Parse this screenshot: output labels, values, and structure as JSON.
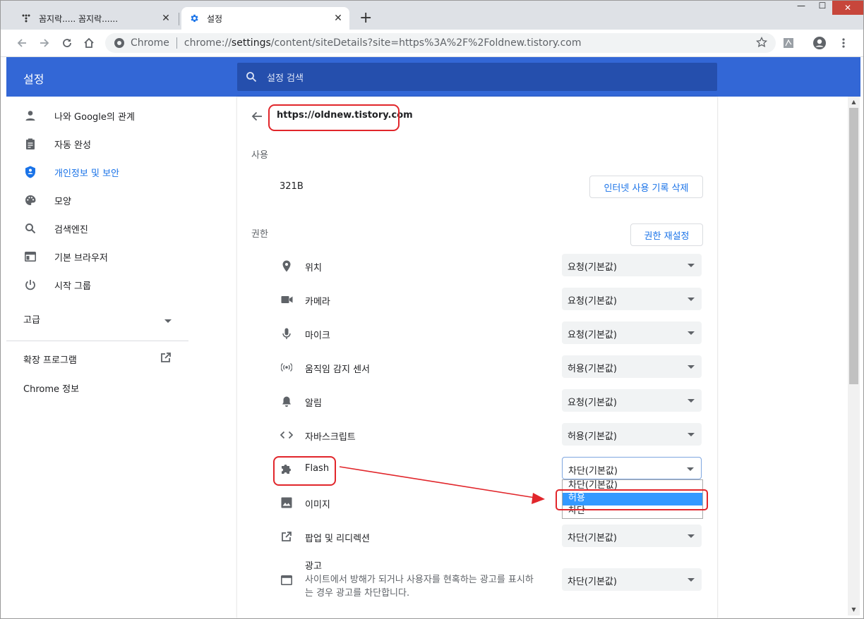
{
  "browser": {
    "tabs": [
      {
        "title": "꼼지락..... 꼼지락......",
        "close": "✕"
      },
      {
        "title": "설정",
        "close": "✕"
      }
    ],
    "new_tab": "+",
    "window_buttons": {
      "minimize": "—",
      "maximize": "☐",
      "close": "✕"
    },
    "omnibox": {
      "chip": "Chrome",
      "url_scheme": "chrome://",
      "url_host": "settings",
      "url_path": "/content/siteDetails?site=https%3A%2F%2Foldnew.tistory.com"
    }
  },
  "header": {
    "title": "설정",
    "search_placeholder": "설정 검색"
  },
  "sidebar": {
    "items": [
      {
        "label": "나와 Google의 관계",
        "icon": "person-icon"
      },
      {
        "label": "자동 완성",
        "icon": "clipboard-icon"
      },
      {
        "label": "개인정보 및 보안",
        "icon": "shield-icon",
        "active": true
      },
      {
        "label": "모양",
        "icon": "palette-icon"
      },
      {
        "label": "검색엔진",
        "icon": "search-icon"
      },
      {
        "label": "기본 브라우저",
        "icon": "browser-icon"
      },
      {
        "label": "시작 그룹",
        "icon": "power-icon"
      }
    ],
    "advanced": "고급",
    "extensions": "확장 프로그램",
    "about": "Chrome 정보"
  },
  "site": {
    "url": "https://oldnew.tistory.com",
    "usage_heading": "사용",
    "usage_value": "321B",
    "clear_button": "인터넷 사용 기록 삭제",
    "permissions_heading": "권한",
    "reset_button": "권한 재설정",
    "permissions": [
      {
        "label": "위치",
        "value": "요청(기본값)",
        "icon": "location-icon"
      },
      {
        "label": "카메라",
        "value": "요청(기본값)",
        "icon": "camera-icon"
      },
      {
        "label": "마이크",
        "value": "요청(기본값)",
        "icon": "mic-icon"
      },
      {
        "label": "움직임 감지 센서",
        "value": "허용(기본값)",
        "icon": "sensors-icon"
      },
      {
        "label": "알림",
        "value": "요청(기본값)",
        "icon": "bell-icon"
      },
      {
        "label": "자바스크립트",
        "value": "허용(기본값)",
        "icon": "code-icon"
      },
      {
        "label": "Flash",
        "value": "차단(기본값)",
        "icon": "puzzle-icon"
      },
      {
        "label": "이미지",
        "value": "",
        "icon": "image-icon"
      },
      {
        "label": "팝업 및 리디렉션",
        "value": "차단(기본값)",
        "icon": "open-external-icon"
      },
      {
        "label": "광고",
        "sublabel_1": "사이트에서 방해가 되거나 사용자를 현혹하는 광고를 표시하",
        "sublabel_2": "는 경우 광고를 차단합니다.",
        "value": "차단(기본값)",
        "icon": "ads-icon"
      }
    ],
    "flash_dropdown_options": [
      "차단(기본값)",
      "허용",
      "차단"
    ],
    "flash_dropdown_selected": "허용"
  },
  "colors": {
    "accent": "#1a73e8",
    "header": "#3367d6",
    "highlight": "#e1262b",
    "selected_option": "#3399ff"
  }
}
